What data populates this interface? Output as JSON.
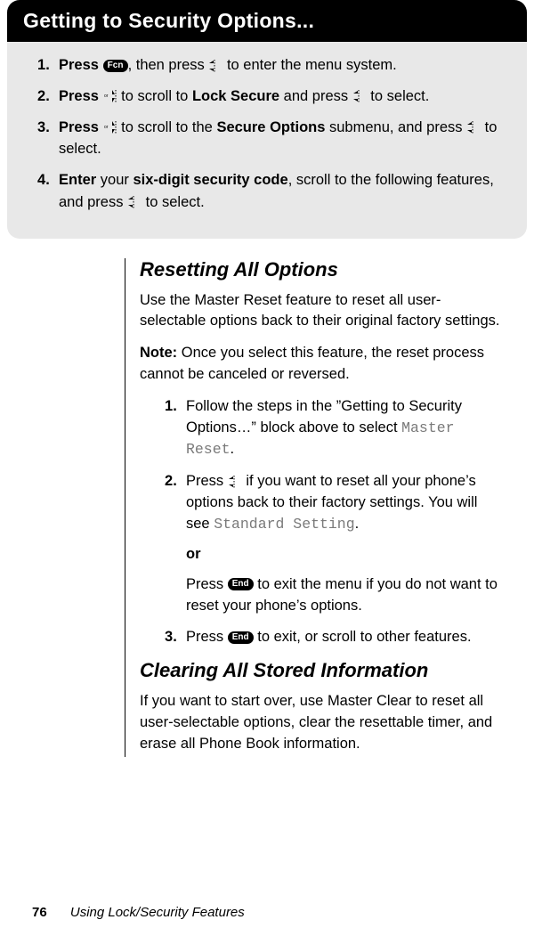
{
  "title": "Getting to Security Options...",
  "steps": [
    {
      "action": "Press",
      "seg1": ", then press ",
      "seg2": " to enter the menu system."
    },
    {
      "action": "Press",
      "seg1": " to scroll to ",
      "bold1": "Lock Secure",
      "seg2": " and press ",
      "seg3": " to select."
    },
    {
      "action": "Press",
      "seg1": " to scroll to the ",
      "bold1": "Secure Options",
      "seg2": " submenu, and press ",
      "seg3": " to select."
    },
    {
      "action": "Enter",
      "seg1": " your ",
      "bold1": "six-digit security code",
      "seg2": ", scroll to the following features, and press ",
      "seg3": " to select."
    }
  ],
  "section1": {
    "heading": "Resetting All Options",
    "para1": "Use the Master Reset feature to reset all user-selectable options back to their original factory settings.",
    "note_label": "Note:",
    "note_text": " Once you select this feature, the reset process cannot be canceled or reversed.",
    "items": {
      "i1a": "Follow the steps in the ”Getting to Security Options…” block above to select ",
      "i1lcd": "Master Reset",
      "i1b": ".",
      "i2a": "Press ",
      "i2b": " if you want to reset all your phone’s options back to their factory settings. You will see ",
      "i2lcd": "Standard Setting",
      "i2c": ".",
      "or": "or",
      "i2d": "Press ",
      "i2e": " to exit the menu if you do not want to reset your phone’s options.",
      "i3a": "Press ",
      "i3b": " to exit, or scroll to other features."
    }
  },
  "section2": {
    "heading": "Clearing All Stored Information",
    "para1": "If you want to start over, use Master Clear to reset all user-selectable options, clear the resettable timer, and erase all Phone Book information."
  },
  "keys": {
    "fcn": "Fcn",
    "end": "End"
  },
  "footer": {
    "page": "76",
    "chapter": "Using Lock/Security Features"
  }
}
